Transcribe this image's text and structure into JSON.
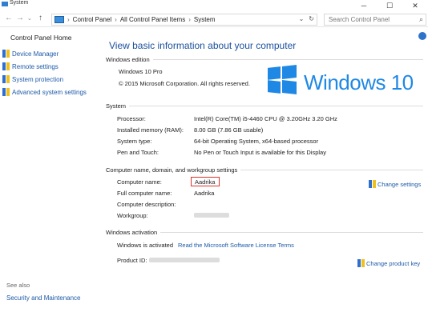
{
  "window": {
    "title": "System",
    "minimize": "─",
    "maximize": "☐",
    "close": "✕"
  },
  "address": {
    "crumbs": [
      "Control Panel",
      "All Control Panel Items",
      "System"
    ],
    "separator": "›",
    "dropdown": "⌄",
    "refresh": "↻",
    "search_placeholder": "Search Control Panel"
  },
  "sidebar": {
    "home": "Control Panel Home",
    "links": [
      "Device Manager",
      "Remote settings",
      "System protection",
      "Advanced system settings"
    ],
    "see_also": "See also",
    "bottom_link": "Security and Maintenance"
  },
  "main": {
    "title": "View basic information about your computer",
    "edition": {
      "heading": "Windows edition",
      "name": "Windows 10 Pro",
      "copyright": "© 2015 Microsoft Corporation. All rights reserved.",
      "logo_text": "Windows 10"
    },
    "system": {
      "heading": "System",
      "rows": [
        {
          "label": "Processor:",
          "value": "Intel(R) Core(TM) i5-4460  CPU @ 3.20GHz   3.20 GHz"
        },
        {
          "label": "Installed memory (RAM):",
          "value": "8.00 GB (7.86 GB usable)"
        },
        {
          "label": "System type:",
          "value": "64-bit Operating System, x64-based processor"
        },
        {
          "label": "Pen and Touch:",
          "value": "No Pen or Touch Input is available for this Display"
        }
      ]
    },
    "computer": {
      "heading": "Computer name, domain, and workgroup settings",
      "rows": [
        {
          "label": "Computer name:",
          "value": "Aadrika"
        },
        {
          "label": "Full computer name:",
          "value": "Aadrika"
        },
        {
          "label": "Computer description:",
          "value": ""
        },
        {
          "label": "Workgroup:",
          "value": ""
        }
      ],
      "change_link": "Change settings"
    },
    "activation": {
      "heading": "Windows activation",
      "status": "Windows is activated",
      "license_link": "Read the Microsoft Software License Terms",
      "product_id_label": "Product ID:",
      "change_key_link": "Change product key"
    }
  },
  "colors": {
    "accent": "#1f88e5",
    "link": "#1c5aa8",
    "title": "#1b4f9c",
    "highlight": "#e0312a"
  }
}
